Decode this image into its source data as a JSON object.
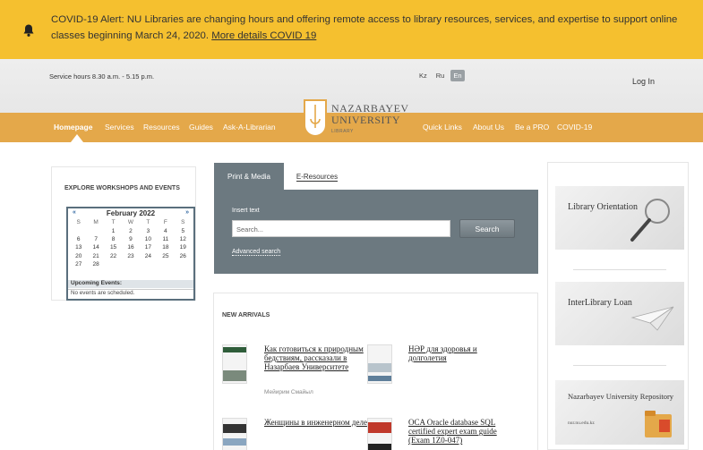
{
  "alert": {
    "text": "COVID-19 Alert: NU Libraries are changing hours and offering remote access to library resources, services, and expertise to support online classes beginning March 24, 2020.",
    "link": "More details COVID 19"
  },
  "header": {
    "hours": "Service hours 8.30 a.m. - 5.15 p.m.",
    "langs": [
      "Kz",
      "Ru",
      "En"
    ],
    "active_lang": "En",
    "login": "Log In"
  },
  "logo": {
    "line1": "NAZARBAYEV",
    "line2": "UNIVERSITY",
    "line3": "LIBRARY"
  },
  "nav": {
    "left": [
      "Homepage",
      "Services",
      "Resources",
      "Guides",
      "Ask-A-Librarian"
    ],
    "right": [
      "Quick Links",
      "About Us",
      "Be a PRO",
      "COVID-19"
    ]
  },
  "events": {
    "title": "EXPLORE WORKSHOPS AND EVENTS",
    "prev": "«",
    "next": "»",
    "month": "February 2022",
    "dow": [
      "S",
      "M",
      "T",
      "W",
      "T",
      "F",
      "S"
    ],
    "weeks": [
      [
        "",
        "",
        "1",
        "2",
        "3",
        "4",
        "5"
      ],
      [
        "6",
        "7",
        "8",
        "9",
        "10",
        "11",
        "12"
      ],
      [
        "13",
        "14",
        "15",
        "16",
        "17",
        "18",
        "19"
      ],
      [
        "20",
        "21",
        "22",
        "23",
        "24",
        "25",
        "26"
      ],
      [
        "27",
        "28",
        "",
        "",
        "",
        "",
        ""
      ]
    ],
    "upcoming": "Upcoming Events:",
    "none": "No events are scheduled."
  },
  "search": {
    "tab1": "Print & Media",
    "tab2": "E-Resources",
    "label": "Insert text",
    "placeholder": "Search...",
    "button": "Search",
    "advanced": "Advanced search"
  },
  "arrivals": {
    "title": "NEW ARRIVALS",
    "books": [
      {
        "title": "Как готовиться к природным бедствиям, рассказали в Назарбаев Университете",
        "author": "Мейирим Смайыл"
      },
      {
        "title": "НӘР для здоровья и долголетия",
        "author": ""
      },
      {
        "title": "Женщины в инженерном деле",
        "author": ""
      },
      {
        "title": "OCA Oracle database SQL certified expert exam guide (Exam 1Z0-047)",
        "author": ""
      }
    ]
  },
  "promos": [
    {
      "text": "Library Orientation"
    },
    {
      "text": "InterLibrary Loan"
    },
    {
      "text": "Nazarbayev University Repository",
      "sub": "nur.nu.edu.kz"
    }
  ],
  "colors": {
    "alert": "#f5c02f",
    "nav": "#e4a84a",
    "search_panel": "#6c7980"
  }
}
